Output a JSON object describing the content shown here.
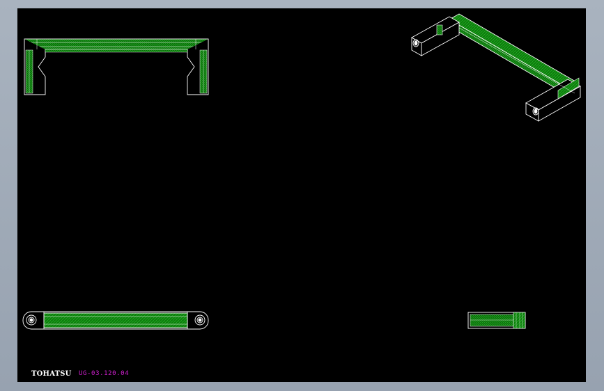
{
  "drawing": {
    "brand": "TOHATSU",
    "part_number": "UG-03.120.04"
  },
  "colors": {
    "background": "#000000",
    "frame": "#a0aab6",
    "outline": "#ffffff",
    "hatch": "#0f8a0f",
    "hatch_line": "#3cd23c",
    "part_number_text": "#d020d0"
  },
  "views": [
    "front-view",
    "isometric-view",
    "top-view",
    "side-view"
  ]
}
